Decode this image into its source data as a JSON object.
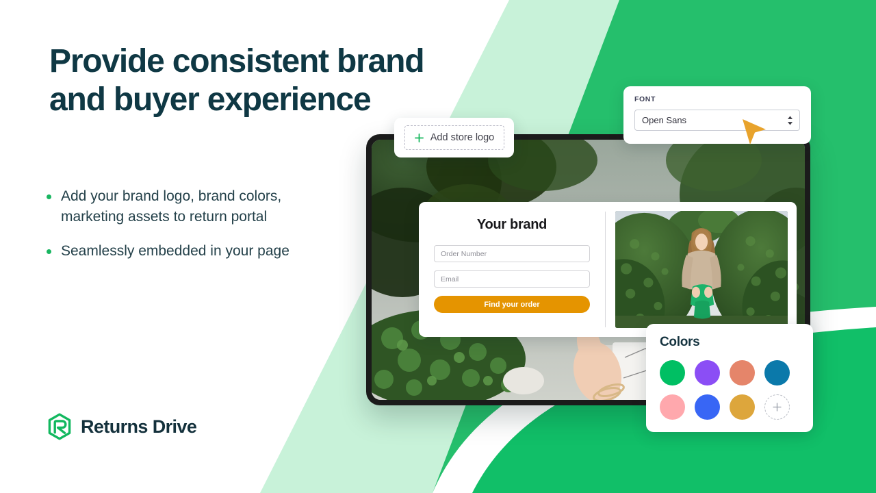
{
  "headline": "Provide consistent brand\nand buyer experience",
  "bullets": [
    {
      "text": "Add your brand logo, brand colors,\nmarketing assets to return portal"
    },
    {
      "text": "Seamlessly embedded in your page"
    }
  ],
  "logo": {
    "text": "Returns Drive"
  },
  "add_logo_card": {
    "label": "Add store logo"
  },
  "font_panel": {
    "label": "FONT",
    "value": "Open Sans"
  },
  "portal": {
    "title": "Your brand",
    "order_number_placeholder": "Order Number",
    "email_placeholder": "Email",
    "submit_label": "Find your order"
  },
  "colors_panel": {
    "title": "Colors",
    "swatches": [
      {
        "name": "green",
        "hex": "#00bf63"
      },
      {
        "name": "purple",
        "hex": "#8b4ef5"
      },
      {
        "name": "salmon",
        "hex": "#e5856a"
      },
      {
        "name": "teal-blue",
        "hex": "#0b79aa"
      },
      {
        "name": "pink",
        "hex": "#ffa8ad"
      },
      {
        "name": "blue",
        "hex": "#3866f5"
      },
      {
        "name": "gold",
        "hex": "#dda63c"
      }
    ],
    "add_swatch_label": "+"
  },
  "theme": {
    "headline_color": "#0f3844",
    "body_text_color": "#234049",
    "brand_green": "#19b661",
    "band_green": "#25bf6c",
    "band_mint": "#c8f2d9",
    "accent_orange": "#e59400",
    "cursor_orange": "#e8a32c",
    "device_bezel": "#1b1b1b"
  }
}
